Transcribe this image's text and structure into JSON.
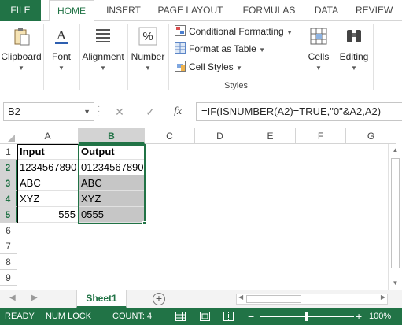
{
  "ribbon_tabs": [
    "FILE",
    "HOME",
    "INSERT",
    "PAGE LAYOUT",
    "FORMULAS",
    "DATA",
    "REVIEW"
  ],
  "active_tab": "HOME",
  "groups": {
    "clipboard": "Clipboard",
    "font": "Font",
    "alignment": "Alignment",
    "number": "Number",
    "cells": "Cells",
    "editing": "Editing"
  },
  "styles": {
    "conditional_formatting": "Conditional Formatting",
    "format_as_table": "Format as Table",
    "cell_styles": "Cell Styles",
    "group_label": "Styles"
  },
  "formula_bar": {
    "name_box": "B2",
    "cancel_glyph": "✕",
    "enter_glyph": "✓",
    "fx_glyph": "fx",
    "formula": "=IF(ISNUMBER(A2)=TRUE,\"0\"&A2,A2)"
  },
  "columns": [
    "A",
    "B",
    "C",
    "D",
    "E",
    "F",
    "G"
  ],
  "rows": [
    "1",
    "2",
    "3",
    "4",
    "5",
    "6",
    "7",
    "8",
    "9"
  ],
  "cells": {
    "A1": "Input",
    "B1": "Output",
    "A2": "1234567890",
    "B2": "01234567890",
    "A3": "ABC",
    "B3": "ABC",
    "A4": "XYZ",
    "B4": "XYZ",
    "A5": "555",
    "B5": "0555"
  },
  "sheet_tab": "Sheet1",
  "status": {
    "mode": "READY",
    "num_lock": "NUM LOCK",
    "count": "COUNT: 4",
    "zoom": "100%"
  },
  "colors": {
    "accent": "#217346",
    "selection_fill": "#c6c6c6"
  }
}
